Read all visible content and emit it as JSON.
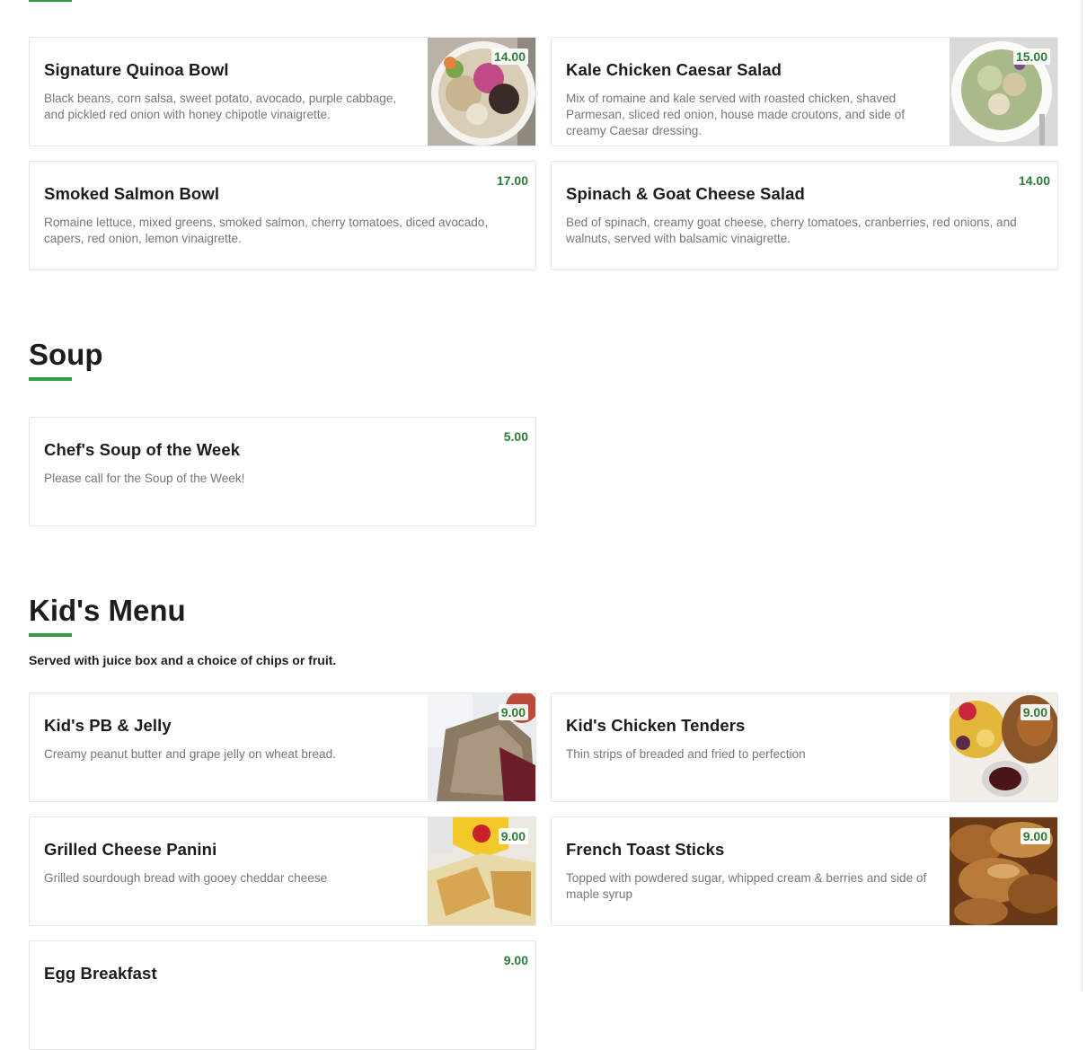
{
  "salads": {
    "items": [
      {
        "name": "Signature Quinoa Bowl",
        "price": "14.00",
        "description": "Black beans, corn salsa, sweet potato, avocado, purple cabbage, and pickled red onion with honey chipotle vinaigrette."
      },
      {
        "name": "Kale Chicken Caesar Salad",
        "price": "15.00",
        "description": "Mix of romaine and kale served with roasted chicken, shaved Parmesan, sliced red onion, house made croutons, and side of creamy Caesar dressing."
      },
      {
        "name": "Smoked Salmon Bowl",
        "price": "17.00",
        "description": "Romaine lettuce, mixed greens, smoked salmon, cherry tomatoes, diced avocado, capers, red onion, lemon vinaigrette."
      },
      {
        "name": "Spinach & Goat Cheese Salad",
        "price": "14.00",
        "description": "Bed of spinach, creamy goat cheese, cherry tomatoes, cranberries, red onions, and walnuts, served with balsamic vinaigrette."
      }
    ]
  },
  "soup": {
    "title": "Soup",
    "items": [
      {
        "name": "Chef's Soup of the Week",
        "price": "5.00",
        "description": "Please call for the Soup of the Week!"
      }
    ]
  },
  "kids": {
    "title": "Kid's Menu",
    "note": "Served with juice box and a choice of chips or fruit.",
    "items": [
      {
        "name": "Kid's PB & Jelly",
        "price": "9.00",
        "description": "Creamy peanut butter and grape jelly on wheat bread."
      },
      {
        "name": "Kid's Chicken Tenders",
        "price": "9.00",
        "description": "Thin strips of breaded and fried to perfection"
      },
      {
        "name": "Grilled Cheese Panini",
        "price": "9.00",
        "description": "Grilled sourdough bread with gooey cheddar cheese"
      },
      {
        "name": "French Toast Sticks",
        "price": "9.00",
        "description": "Topped with powdered sugar, whipped cream & berries and side of maple syrup"
      },
      {
        "name": "Egg Breakfast",
        "price": "9.00",
        "description": ""
      }
    ]
  },
  "colors": {
    "accent": "#2e9b45",
    "price": "#2a7d36"
  }
}
